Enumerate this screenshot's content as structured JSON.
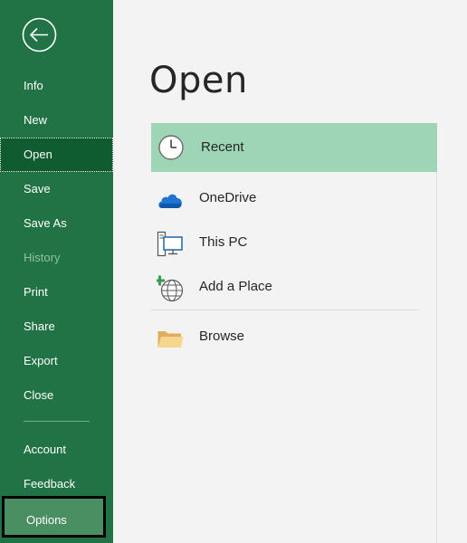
{
  "sidebar": {
    "back_icon": "back-arrow-icon",
    "items": [
      {
        "label": "Info"
      },
      {
        "label": "New"
      },
      {
        "label": "Open"
      },
      {
        "label": "Save"
      },
      {
        "label": "Save As"
      },
      {
        "label": "History"
      },
      {
        "label": "Print"
      },
      {
        "label": "Share"
      },
      {
        "label": "Export"
      },
      {
        "label": "Close"
      },
      {
        "label": "Account"
      },
      {
        "label": "Feedback"
      },
      {
        "label": "Options"
      }
    ],
    "selected": "Open",
    "disabled": [
      "History"
    ]
  },
  "main": {
    "title": "Open",
    "locations": [
      {
        "label": "Recent",
        "icon": "clock-icon"
      },
      {
        "label": "OneDrive",
        "icon": "cloud-icon"
      },
      {
        "label": "This PC",
        "icon": "computer-icon"
      },
      {
        "label": "Add a Place",
        "icon": "add-place-globe-icon"
      },
      {
        "label": "Browse",
        "icon": "folder-icon"
      }
    ],
    "selected": "Recent"
  },
  "colors": {
    "sidebar_bg": "#217346",
    "selected_nav_bg": "#0e5c2f",
    "selected_location_bg": "#9fd5b7",
    "content_bg": "#f3f3f3"
  }
}
